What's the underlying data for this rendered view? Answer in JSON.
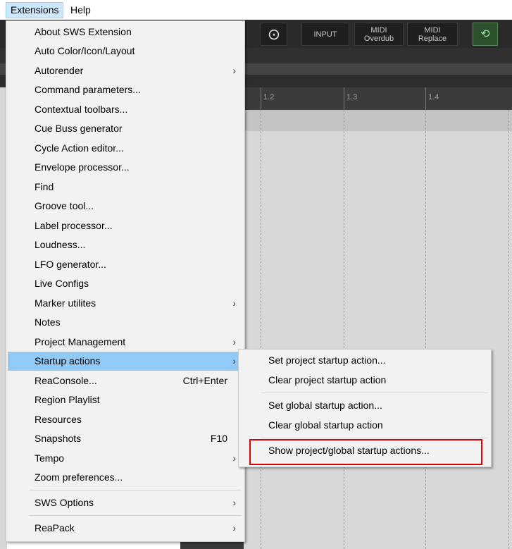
{
  "menubar": {
    "items": [
      {
        "label": "Extensions"
      },
      {
        "label": "Help"
      }
    ]
  },
  "toolbar": {
    "buttons": [
      {
        "line1": "INPUT",
        "line2": ""
      },
      {
        "line1": "MIDI",
        "line2": "Overdub"
      },
      {
        "line1": "MIDI",
        "line2": "Replace"
      }
    ]
  },
  "ruler": {
    "marks": [
      "1.2",
      "1.3",
      "1.4"
    ]
  },
  "extensions_menu": {
    "items": [
      {
        "label": "About SWS Extension",
        "shortcut": "",
        "submenu": false
      },
      {
        "label": "Auto Color/Icon/Layout",
        "shortcut": "",
        "submenu": false
      },
      {
        "label": "Autorender",
        "shortcut": "",
        "submenu": true
      },
      {
        "label": "Command parameters...",
        "shortcut": "",
        "submenu": false
      },
      {
        "label": "Contextual toolbars...",
        "shortcut": "",
        "submenu": false
      },
      {
        "label": "Cue Buss generator",
        "shortcut": "",
        "submenu": false
      },
      {
        "label": "Cycle Action editor...",
        "shortcut": "",
        "submenu": false
      },
      {
        "label": "Envelope processor...",
        "shortcut": "",
        "submenu": false
      },
      {
        "label": "Find",
        "shortcut": "",
        "submenu": false
      },
      {
        "label": "Groove tool...",
        "shortcut": "",
        "submenu": false
      },
      {
        "label": "Label processor...",
        "shortcut": "",
        "submenu": false
      },
      {
        "label": "Loudness...",
        "shortcut": "",
        "submenu": false
      },
      {
        "label": "LFO generator...",
        "shortcut": "",
        "submenu": false
      },
      {
        "label": "Live Configs",
        "shortcut": "",
        "submenu": false
      },
      {
        "label": "Marker utilites",
        "shortcut": "",
        "submenu": true
      },
      {
        "label": "Notes",
        "shortcut": "",
        "submenu": false
      },
      {
        "label": "Project Management",
        "shortcut": "",
        "submenu": true
      },
      {
        "label": "Startup actions",
        "shortcut": "",
        "submenu": true
      },
      {
        "label": "ReaConsole...",
        "shortcut": "Ctrl+Enter",
        "submenu": false
      },
      {
        "label": "Region Playlist",
        "shortcut": "",
        "submenu": false
      },
      {
        "label": "Resources",
        "shortcut": "",
        "submenu": false
      },
      {
        "label": "Snapshots",
        "shortcut": "F10",
        "submenu": false
      },
      {
        "label": "Tempo",
        "shortcut": "",
        "submenu": true
      },
      {
        "label": "Zoom preferences...",
        "shortcut": "",
        "submenu": false
      },
      {
        "label": "SWS Options",
        "shortcut": "",
        "submenu": true
      },
      {
        "label": "ReaPack",
        "shortcut": "",
        "submenu": true
      }
    ],
    "highlighted": "Startup actions"
  },
  "startup_submenu": {
    "items": [
      {
        "label": "Set project startup action..."
      },
      {
        "label": "Clear project startup action"
      },
      {
        "label": "Set global startup action..."
      },
      {
        "label": "Clear global startup action"
      },
      {
        "label": "Show project/global startup actions..."
      }
    ],
    "boxed_item": "Show project/global startup actions..."
  },
  "colors": {
    "menu_highlight": "#91c9f7",
    "menubar_active": "#cce8ff",
    "callout_border": "#e00000"
  }
}
